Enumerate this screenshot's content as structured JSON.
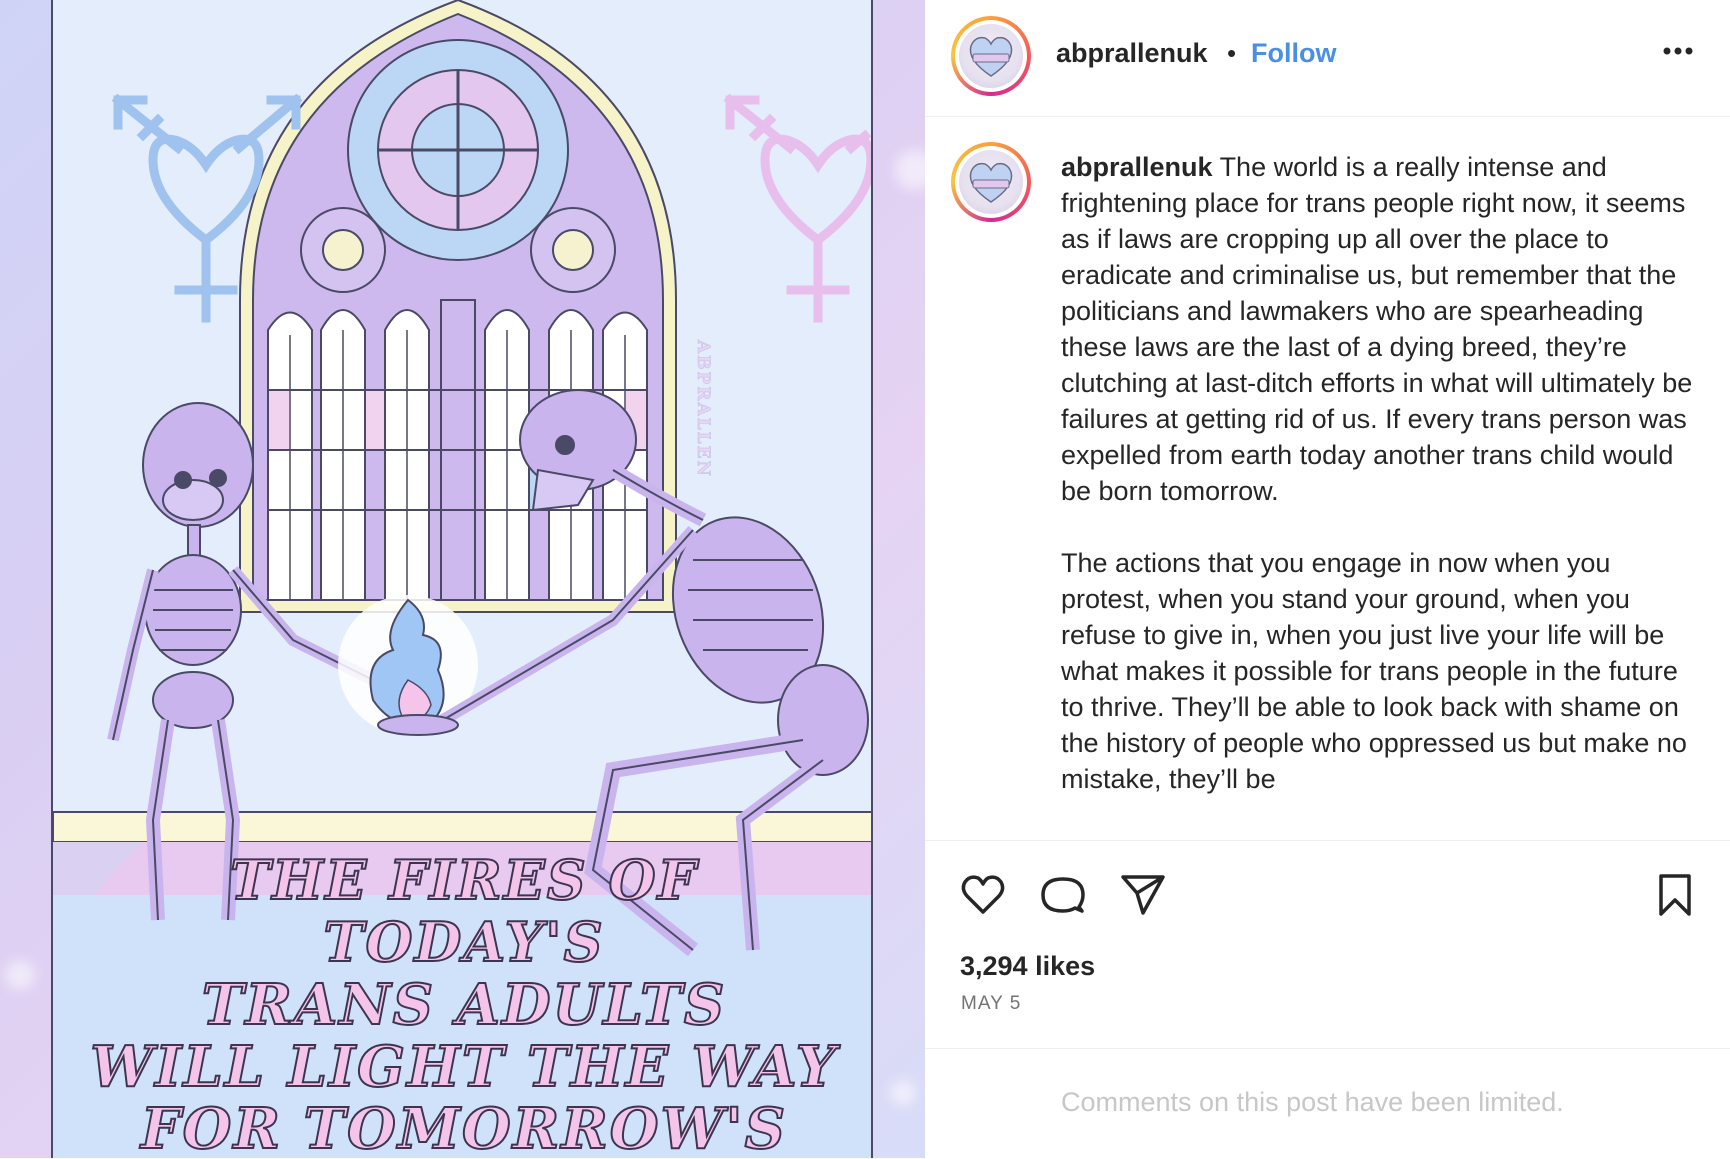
{
  "post": {
    "username": "abprallenuk",
    "separator": "•",
    "follow_label": "Follow",
    "more_label": "More options"
  },
  "artwork": {
    "watermark": "ABPRALLEN",
    "lines": [
      "The fires of",
      "today's",
      "trans adults",
      "will light the way",
      "for tomorrow's"
    ]
  },
  "caption": {
    "username": "abprallenuk",
    "paragraph1": "The world is a really intense and frightening place for trans people right now, it seems as if laws are cropping up all over the place to eradicate and criminalise us, but remember that the politicians and lawmakers who are spearheading these laws are the last of a dying breed, they’re clutching at last-ditch efforts in what will ultimately be failures at getting rid of us. If every trans person was expelled from earth today another trans child would be born tomorrow.",
    "paragraph2": "The actions that you engage in now when you protest, when you stand your ground, when you refuse to give in, when you just live your life will be what makes it possible for trans people in the future to thrive. They’ll be able to look back with shame on the history of people who oppressed us but make no mistake, they’ll be"
  },
  "actions": {
    "icons": [
      "heart-icon",
      "comment-icon",
      "share-icon",
      "bookmark-icon"
    ],
    "likes": "3,294 likes",
    "date": "MAY 5"
  },
  "comments": {
    "limited_text": "Comments on this post have been limited."
  },
  "colors": {
    "follow": "#4a8fe4",
    "text": "#262626",
    "muted": "#737373",
    "lilac": "#c9b4ee",
    "pink": "#f4c4ea",
    "sky": "#bcd6f6"
  }
}
